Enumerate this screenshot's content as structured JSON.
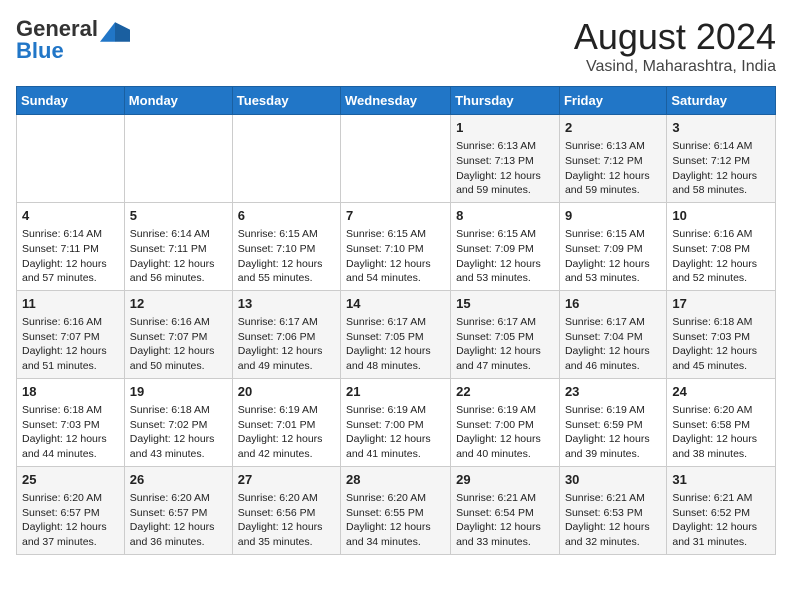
{
  "header": {
    "logo_general": "General",
    "logo_blue": "Blue",
    "month_year": "August 2024",
    "location": "Vasind, Maharashtra, India"
  },
  "weekdays": [
    "Sunday",
    "Monday",
    "Tuesday",
    "Wednesday",
    "Thursday",
    "Friday",
    "Saturday"
  ],
  "weeks": [
    [
      {
        "day": "",
        "info": ""
      },
      {
        "day": "",
        "info": ""
      },
      {
        "day": "",
        "info": ""
      },
      {
        "day": "",
        "info": ""
      },
      {
        "day": "1",
        "info": "Sunrise: 6:13 AM\nSunset: 7:13 PM\nDaylight: 12 hours and 59 minutes."
      },
      {
        "day": "2",
        "info": "Sunrise: 6:13 AM\nSunset: 7:12 PM\nDaylight: 12 hours and 59 minutes."
      },
      {
        "day": "3",
        "info": "Sunrise: 6:14 AM\nSunset: 7:12 PM\nDaylight: 12 hours and 58 minutes."
      }
    ],
    [
      {
        "day": "4",
        "info": "Sunrise: 6:14 AM\nSunset: 7:11 PM\nDaylight: 12 hours and 57 minutes."
      },
      {
        "day": "5",
        "info": "Sunrise: 6:14 AM\nSunset: 7:11 PM\nDaylight: 12 hours and 56 minutes."
      },
      {
        "day": "6",
        "info": "Sunrise: 6:15 AM\nSunset: 7:10 PM\nDaylight: 12 hours and 55 minutes."
      },
      {
        "day": "7",
        "info": "Sunrise: 6:15 AM\nSunset: 7:10 PM\nDaylight: 12 hours and 54 minutes."
      },
      {
        "day": "8",
        "info": "Sunrise: 6:15 AM\nSunset: 7:09 PM\nDaylight: 12 hours and 53 minutes."
      },
      {
        "day": "9",
        "info": "Sunrise: 6:15 AM\nSunset: 7:09 PM\nDaylight: 12 hours and 53 minutes."
      },
      {
        "day": "10",
        "info": "Sunrise: 6:16 AM\nSunset: 7:08 PM\nDaylight: 12 hours and 52 minutes."
      }
    ],
    [
      {
        "day": "11",
        "info": "Sunrise: 6:16 AM\nSunset: 7:07 PM\nDaylight: 12 hours and 51 minutes."
      },
      {
        "day": "12",
        "info": "Sunrise: 6:16 AM\nSunset: 7:07 PM\nDaylight: 12 hours and 50 minutes."
      },
      {
        "day": "13",
        "info": "Sunrise: 6:17 AM\nSunset: 7:06 PM\nDaylight: 12 hours and 49 minutes."
      },
      {
        "day": "14",
        "info": "Sunrise: 6:17 AM\nSunset: 7:05 PM\nDaylight: 12 hours and 48 minutes."
      },
      {
        "day": "15",
        "info": "Sunrise: 6:17 AM\nSunset: 7:05 PM\nDaylight: 12 hours and 47 minutes."
      },
      {
        "day": "16",
        "info": "Sunrise: 6:17 AM\nSunset: 7:04 PM\nDaylight: 12 hours and 46 minutes."
      },
      {
        "day": "17",
        "info": "Sunrise: 6:18 AM\nSunset: 7:03 PM\nDaylight: 12 hours and 45 minutes."
      }
    ],
    [
      {
        "day": "18",
        "info": "Sunrise: 6:18 AM\nSunset: 7:03 PM\nDaylight: 12 hours and 44 minutes."
      },
      {
        "day": "19",
        "info": "Sunrise: 6:18 AM\nSunset: 7:02 PM\nDaylight: 12 hours and 43 minutes."
      },
      {
        "day": "20",
        "info": "Sunrise: 6:19 AM\nSunset: 7:01 PM\nDaylight: 12 hours and 42 minutes."
      },
      {
        "day": "21",
        "info": "Sunrise: 6:19 AM\nSunset: 7:00 PM\nDaylight: 12 hours and 41 minutes."
      },
      {
        "day": "22",
        "info": "Sunrise: 6:19 AM\nSunset: 7:00 PM\nDaylight: 12 hours and 40 minutes."
      },
      {
        "day": "23",
        "info": "Sunrise: 6:19 AM\nSunset: 6:59 PM\nDaylight: 12 hours and 39 minutes."
      },
      {
        "day": "24",
        "info": "Sunrise: 6:20 AM\nSunset: 6:58 PM\nDaylight: 12 hours and 38 minutes."
      }
    ],
    [
      {
        "day": "25",
        "info": "Sunrise: 6:20 AM\nSunset: 6:57 PM\nDaylight: 12 hours and 37 minutes."
      },
      {
        "day": "26",
        "info": "Sunrise: 6:20 AM\nSunset: 6:57 PM\nDaylight: 12 hours and 36 minutes."
      },
      {
        "day": "27",
        "info": "Sunrise: 6:20 AM\nSunset: 6:56 PM\nDaylight: 12 hours and 35 minutes."
      },
      {
        "day": "28",
        "info": "Sunrise: 6:20 AM\nSunset: 6:55 PM\nDaylight: 12 hours and 34 minutes."
      },
      {
        "day": "29",
        "info": "Sunrise: 6:21 AM\nSunset: 6:54 PM\nDaylight: 12 hours and 33 minutes."
      },
      {
        "day": "30",
        "info": "Sunrise: 6:21 AM\nSunset: 6:53 PM\nDaylight: 12 hours and 32 minutes."
      },
      {
        "day": "31",
        "info": "Sunrise: 6:21 AM\nSunset: 6:52 PM\nDaylight: 12 hours and 31 minutes."
      }
    ]
  ]
}
